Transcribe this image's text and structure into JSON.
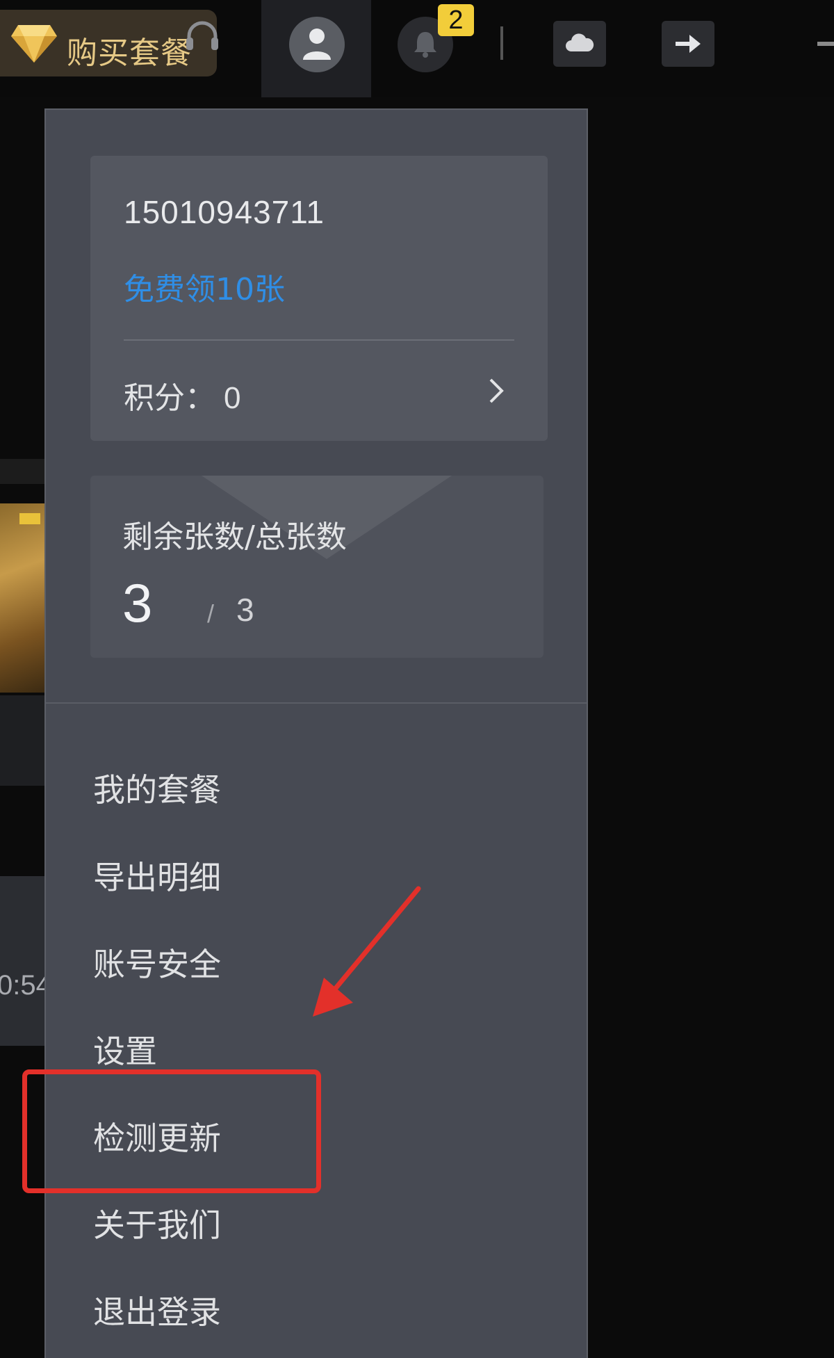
{
  "topbar": {
    "buy_label": "购买套餐",
    "notification_count": "2",
    "icons": [
      "diamond-icon",
      "headset-icon",
      "user-icon",
      "bell-icon",
      "cloud-icon",
      "export-icon",
      "minimize-icon"
    ]
  },
  "account": {
    "phone": "15010943711",
    "free_link": "免费领10张",
    "points_label": "积分：",
    "points_value": "0"
  },
  "quota": {
    "title": "剩余张数/总张数",
    "remaining": "3",
    "separator": "/",
    "total": "3"
  },
  "menu": {
    "items": [
      {
        "label": "我的套餐"
      },
      {
        "label": "导出明细"
      },
      {
        "label": "账号安全"
      },
      {
        "label": "设置"
      },
      {
        "label": "检测更新"
      },
      {
        "label": "关于我们"
      },
      {
        "label": "退出登录"
      }
    ]
  },
  "background": {
    "time_text": "0:54"
  },
  "colors": {
    "accent_blue": "#2f8ee6",
    "highlight_red": "#e3302a",
    "badge_yellow": "#f2cd3a",
    "gold_text": "#e6c986"
  }
}
